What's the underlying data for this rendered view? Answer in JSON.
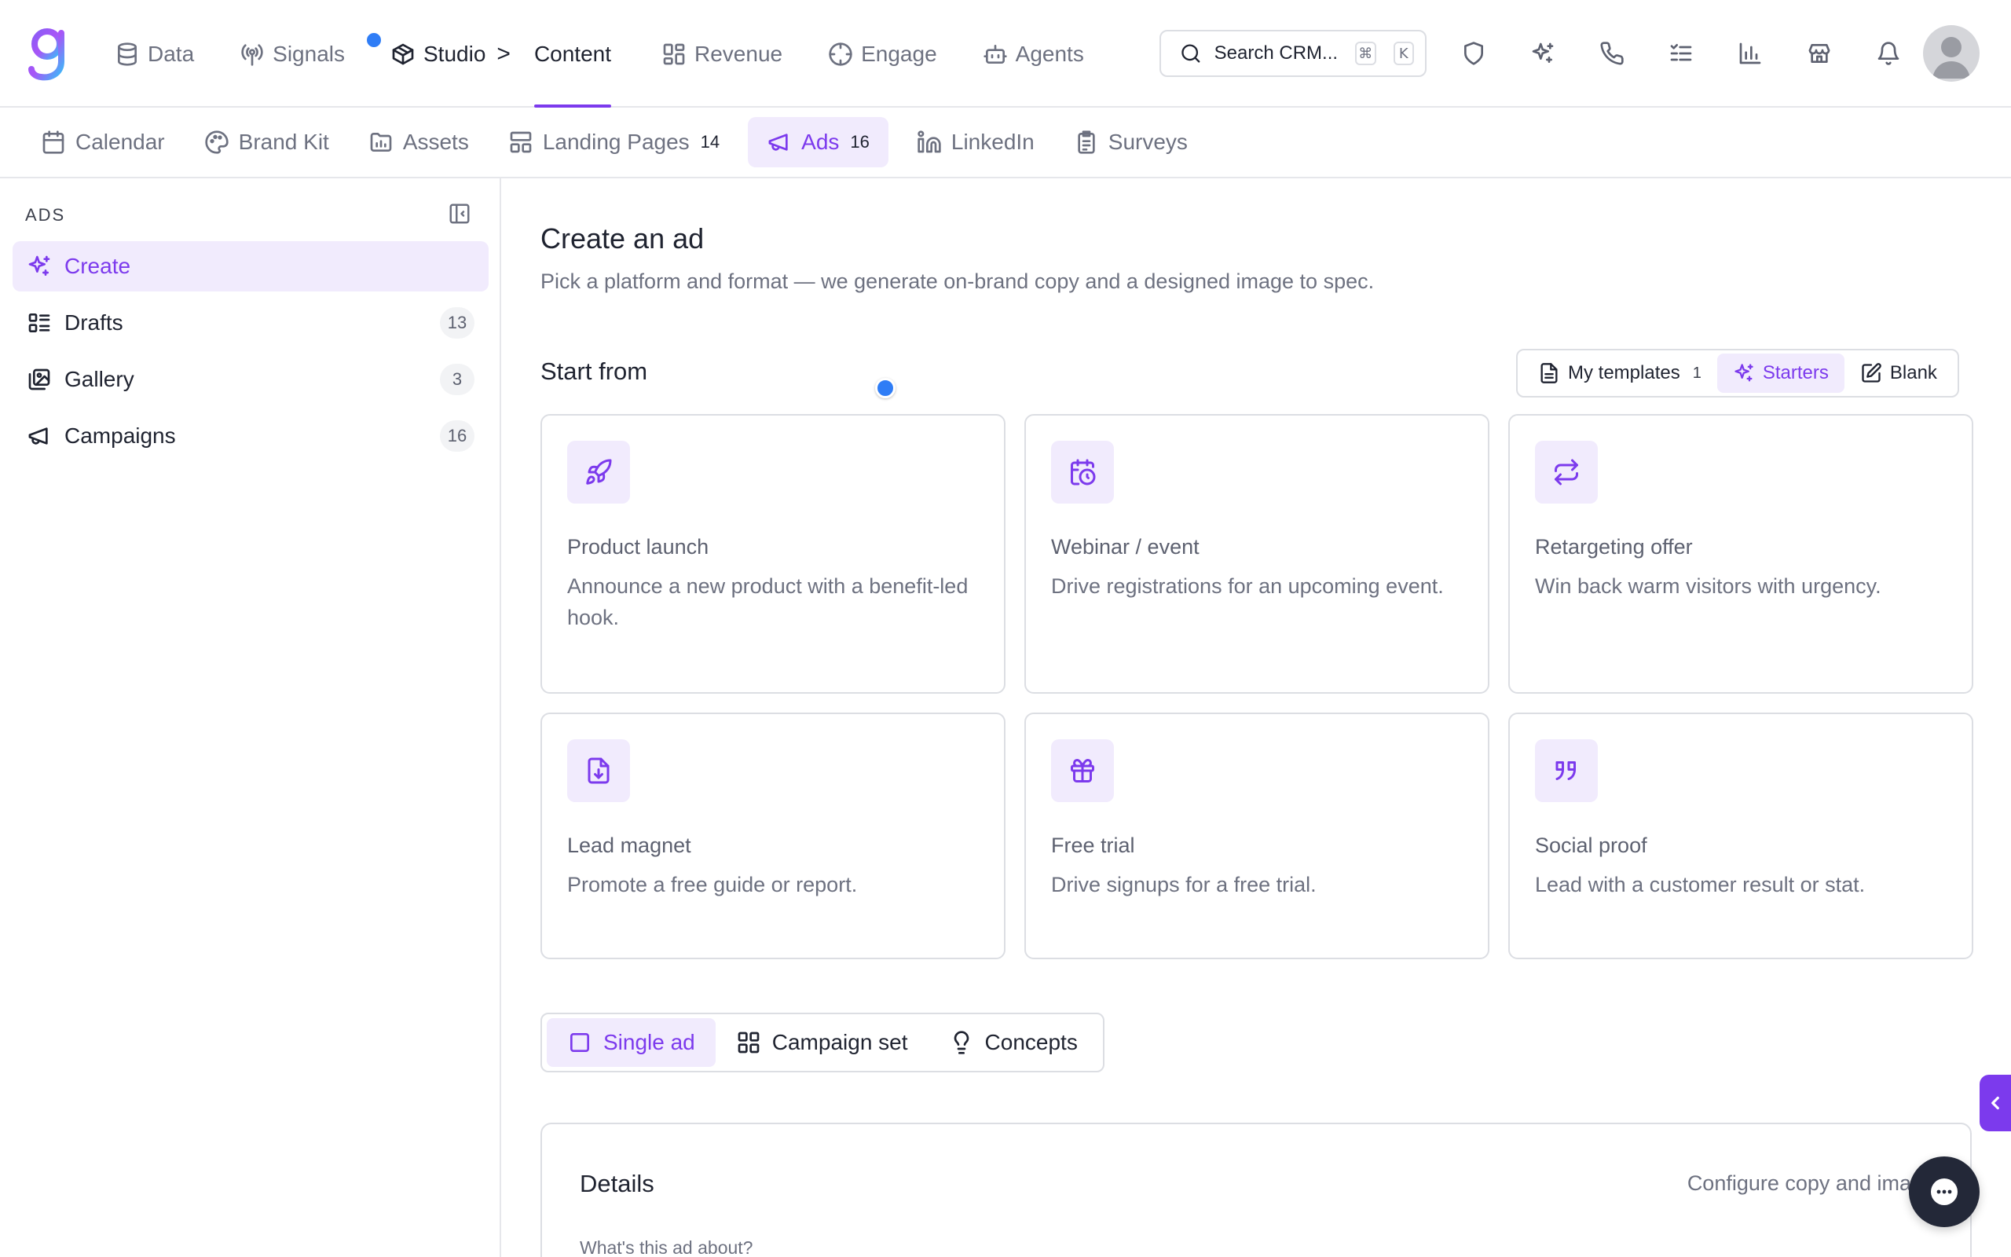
{
  "topnav": {
    "items": [
      {
        "label": "Data",
        "icon": "database-icon"
      },
      {
        "label": "Signals",
        "icon": "broadcast-icon"
      },
      {
        "label": "Studio",
        "icon": "package-icon"
      },
      {
        "label": "Content",
        "icon": ""
      },
      {
        "label": "Revenue",
        "icon": "grid-icon"
      },
      {
        "label": "Engage",
        "icon": "crosshair-icon"
      },
      {
        "label": "Agents",
        "icon": "bot-icon"
      }
    ],
    "breadcrumb_sep": ">",
    "active": "Content"
  },
  "search": {
    "placeholder": "Search CRM...",
    "kbd_mod": "⌘",
    "kbd_key": "K"
  },
  "tool_icons": [
    "shield-icon",
    "sparkles-icon",
    "phone-icon",
    "checklist-icon",
    "bar-chart-icon",
    "store-icon",
    "bell-icon"
  ],
  "subtabs": [
    {
      "label": "Calendar",
      "count": ""
    },
    {
      "label": "Brand Kit",
      "count": ""
    },
    {
      "label": "Assets",
      "count": ""
    },
    {
      "label": "Landing Pages",
      "count": "14"
    },
    {
      "label": "Ads",
      "count": "16"
    },
    {
      "label": "LinkedIn",
      "count": ""
    },
    {
      "label": "Surveys",
      "count": ""
    }
  ],
  "sidebar": {
    "title": "ADS",
    "items": [
      {
        "label": "Create",
        "count": ""
      },
      {
        "label": "Drafts",
        "count": "13"
      },
      {
        "label": "Gallery",
        "count": "3"
      },
      {
        "label": "Campaigns",
        "count": "16"
      }
    ]
  },
  "main": {
    "title": "Create an ad",
    "subtitle": "Pick a platform and format — we generate on-brand copy and a designed image to spec.",
    "start_from": "Start from",
    "start_options": [
      {
        "label": "My templates",
        "count": "1"
      },
      {
        "label": "Starters",
        "count": ""
      },
      {
        "label": "Blank",
        "count": ""
      }
    ],
    "cards": [
      {
        "title": "Product launch",
        "desc": "Announce a new product with a benefit-led hook.",
        "icon": "rocket-icon"
      },
      {
        "title": "Webinar / event",
        "desc": "Drive registrations for an upcoming event.",
        "icon": "calendar-clock-icon"
      },
      {
        "title": "Retargeting offer",
        "desc": "Win back warm visitors with urgency.",
        "icon": "repeat-icon"
      },
      {
        "title": "Lead magnet",
        "desc": "Promote a free guide or report.",
        "icon": "file-download-icon"
      },
      {
        "title": "Free trial",
        "desc": "Drive signups for a free trial.",
        "icon": "gift-icon"
      },
      {
        "title": "Social proof",
        "desc": "Lead with a customer result or stat.",
        "icon": "quote-icon"
      }
    ],
    "modes": [
      {
        "label": "Single ad"
      },
      {
        "label": "Campaign set"
      },
      {
        "label": "Concepts"
      }
    ],
    "details": {
      "title": "Details",
      "right": "Configure copy and imag",
      "question": "What's this ad about?"
    }
  },
  "colors": {
    "accent": "#7c3aed",
    "accent_bg": "#f1ebfd",
    "cursor": "#2f7df6",
    "border": "#dcdee3"
  }
}
